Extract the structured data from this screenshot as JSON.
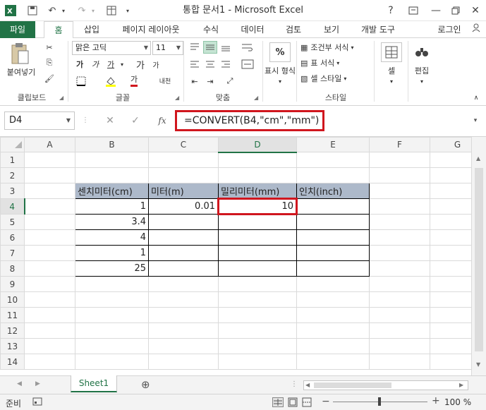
{
  "window": {
    "title": "통합 문서1 - Microsoft Excel",
    "help": "?",
    "signin": "로그인"
  },
  "ribbon": {
    "tabs": [
      "파일",
      "홈",
      "삽입",
      "페이지 레이아웃",
      "수식",
      "데이터",
      "검토",
      "보기",
      "개발 도구"
    ],
    "active_tab": "홈",
    "clipboard": {
      "paste": "붙여넣기",
      "label": "클립보드"
    },
    "font": {
      "name": "맑은 고딕",
      "size": "11",
      "label": "글꼴",
      "bold": "가",
      "italic": "가",
      "underline": "가",
      "grow": "가",
      "shrink": "가",
      "phonetic": "내천",
      "fontcolor": "가"
    },
    "alignment": {
      "label": "맞춤"
    },
    "number": {
      "format": "%",
      "format_label": "표시 형식",
      "label": ""
    },
    "styles": {
      "conditional": "조건부 서식",
      "table": "표 서식",
      "cell": "셀 스타일",
      "label": "스타일"
    },
    "cells": {
      "label": "셀"
    },
    "editing": {
      "label": "편집"
    }
  },
  "formula_bar": {
    "name_box": "D4",
    "fx": "fx",
    "formula": "=CONVERT(B4,\"cm\",\"mm\")"
  },
  "grid": {
    "columns": [
      "A",
      "B",
      "C",
      "D",
      "E",
      "F",
      "G"
    ],
    "rows": [
      "1",
      "2",
      "3",
      "4",
      "5",
      "6",
      "7",
      "8",
      "9",
      "10",
      "11",
      "12",
      "13",
      "14"
    ],
    "headers": {
      "B3": "센치미터(cm)",
      "C3": "미터(m)",
      "D3": "밀리미터(mm)",
      "E3": "인치(inch)"
    },
    "values": {
      "B4": "1",
      "C4": "0.01",
      "D4": "10",
      "B5": "3.4",
      "B6": "4",
      "B7": "1",
      "B8": "25"
    }
  },
  "sheet_tabs": {
    "active": "Sheet1",
    "add": "⊕"
  },
  "status": {
    "ready": "준비",
    "zoom": "100 %",
    "minus": "−",
    "plus": "+"
  },
  "colors": {
    "excel_green": "#217346",
    "highlight_red": "#d0161e",
    "header_fill": "#adb9ca"
  }
}
